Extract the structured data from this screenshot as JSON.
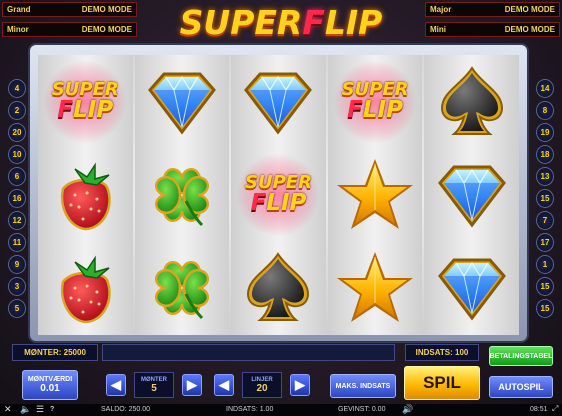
{
  "jackpots": {
    "grand": {
      "name": "Grand",
      "value": "DEMO MODE"
    },
    "minor": {
      "name": "Minor",
      "value": "DEMO MODE"
    },
    "major": {
      "name": "Major",
      "value": "DEMO MODE"
    },
    "mini": {
      "name": "Mini",
      "value": "DEMO MODE"
    }
  },
  "logo": {
    "part1": "SUPER",
    "part2": "F",
    "part3": "LIP"
  },
  "reels": [
    [
      "superflip",
      "strawberry",
      "strawberry"
    ],
    [
      "diamond",
      "clover",
      "clover"
    ],
    [
      "diamond",
      "superflip",
      "spade"
    ],
    [
      "superflip",
      "star",
      "star"
    ],
    [
      "spade",
      "diamond",
      "diamond"
    ]
  ],
  "superflip_symbol": {
    "top": "SUPER",
    "f": "F",
    "rest": "LIP"
  },
  "left_lines": [
    "4",
    "2",
    "20",
    "10",
    "6",
    "16",
    "12",
    "11",
    "9",
    "3",
    "5"
  ],
  "right_lines": [
    "14",
    "8",
    "19",
    "18",
    "13",
    "15",
    "7",
    "17",
    "1",
    "15",
    "15"
  ],
  "panel": {
    "coins": "MØNTER: 25000",
    "bet": "INDSATS: 100",
    "paytable": "BETALINGSTABEL",
    "coin_value_label": "MØNTVÆRDI",
    "coin_value": "0.01",
    "coins_label": "MØNTER",
    "coins_value": "5",
    "lines_label": "LINJER",
    "lines_value": "20",
    "max_bet": "MAKS. INDSATS",
    "spin": "SPIL",
    "autoplay": "AUTOSPIL"
  },
  "status": {
    "balance": "SALDO: 250.00",
    "bet": "INDSATS: 1.00",
    "win": "GEVINST: 0.00",
    "time": "08:51",
    "help": "?"
  },
  "colors": {
    "accent": "#f5d15a",
    "logo_red": "#ff2a4a",
    "panel": "#0b0f2a"
  }
}
